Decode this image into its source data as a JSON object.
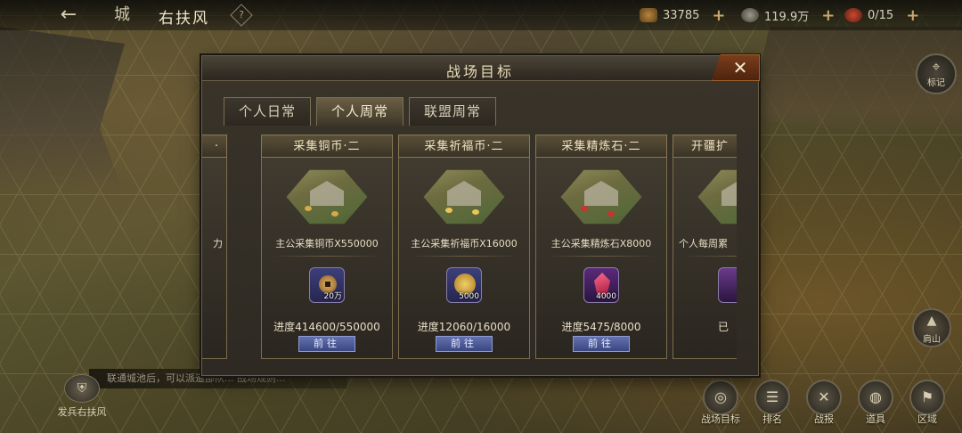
{
  "topbar": {
    "back_icon": "←",
    "city_icon": "城",
    "city_name": "右扶风",
    "help_icon": "?",
    "resources": [
      {
        "name": "copper",
        "value": "33785"
      },
      {
        "name": "coin",
        "value": "119.9万"
      },
      {
        "name": "troops",
        "value": "0/15"
      }
    ]
  },
  "right_buttons": {
    "mark_label": "标记",
    "mountain_label": "肩山"
  },
  "notice_text": "联通城池后，可以派遣部队...  战场规则...",
  "dispatch_label": "发兵右扶风",
  "bottom_buttons": [
    {
      "label": "战场目标",
      "icon": "target-icon",
      "glyph": "◎"
    },
    {
      "label": "排名",
      "icon": "ranking-icon",
      "glyph": "☰"
    },
    {
      "label": "战报",
      "icon": "battle-report-icon",
      "glyph": "✕"
    },
    {
      "label": "道具",
      "icon": "bag-icon",
      "glyph": "◍"
    },
    {
      "label": "区域",
      "icon": "region-flag-icon",
      "glyph": "⚑"
    }
  ],
  "panel": {
    "title": "战场目标",
    "close_icon": "✕",
    "tabs": [
      {
        "label": "个人日常",
        "active": false
      },
      {
        "label": "个人周常",
        "active": true
      },
      {
        "label": "联盟周常",
        "active": false
      }
    ],
    "cards": [
      {
        "title": "·",
        "desc": "力",
        "reward_amount": "",
        "progress": "",
        "button": "",
        "partial": true
      },
      {
        "title": "采集铜币·二",
        "desc": "主公采集铜币X550000",
        "reward_amount": "20万",
        "reward_icon": "copper-coin-icon",
        "progress": "进度414600/550000",
        "button": "前往"
      },
      {
        "title": "采集祈福币·二",
        "desc": "主公采集祈福币X16000",
        "reward_amount": "5000",
        "reward_icon": "blessing-coin-icon",
        "progress": "进度12060/16000",
        "button": "前往"
      },
      {
        "title": "采集精炼石·二",
        "desc": "主公采集精炼石X8000",
        "reward_amount": "4000",
        "reward_icon": "refine-stone-icon",
        "progress": "进度5475/8000",
        "button": "前往"
      },
      {
        "title": "开疆扩",
        "desc": "个人每周累",
        "reward_amount": "",
        "reward_icon": "item-icon",
        "progress": "已",
        "button": "",
        "partial": true
      }
    ]
  },
  "colors": {
    "accent_gold": "#eadcb4",
    "button_blue": "#4b5a9a",
    "close_red": "#7a3d1c"
  }
}
